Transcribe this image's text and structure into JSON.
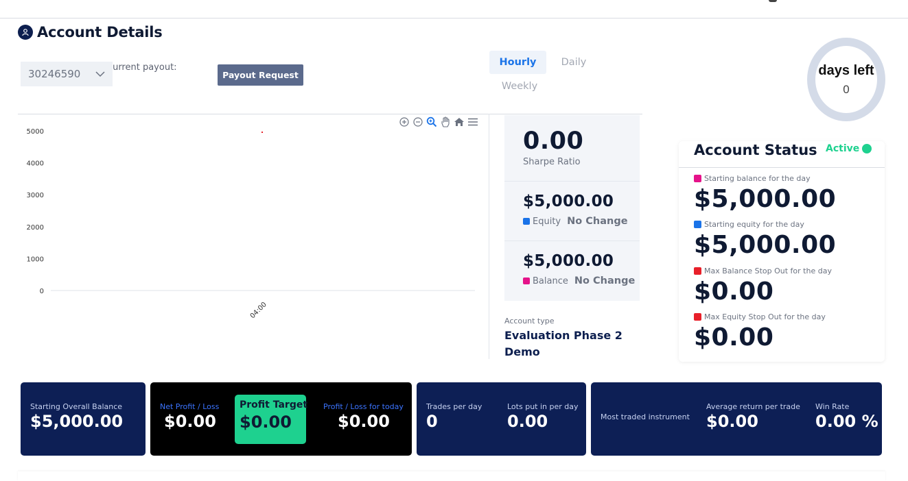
{
  "header": {
    "title": "Account Details"
  },
  "account": {
    "selected_id": "30246590",
    "current_payout_label": "Current payout:"
  },
  "payout_button_label": "Payout Request",
  "tabs": [
    {
      "label": "Hourly",
      "active": true
    },
    {
      "label": "Daily",
      "active": false
    },
    {
      "label": "Weekly",
      "active": false
    }
  ],
  "days_left": {
    "title": "days left",
    "value": "0"
  },
  "chart_data": {
    "type": "line",
    "x": [
      "04:00"
    ],
    "ylim": [
      0,
      5000
    ],
    "yticks": [
      "5000",
      "4000",
      "3000",
      "2000",
      "1000",
      "0"
    ],
    "series": [
      {
        "values": [
          5000
        ]
      }
    ],
    "colors": {
      "point": "#e8202a"
    },
    "grid": false
  },
  "chart_tools": [
    "zoom-in-icon",
    "zoom-out-icon",
    "zoom-select-icon",
    "pan-hand-icon",
    "home-icon",
    "menu-icon"
  ],
  "metrics": {
    "sharpe": {
      "value": "0.00",
      "label": "Sharpe Ratio"
    },
    "equity": {
      "value": "$5,000.00",
      "label": "Equity",
      "change": "No Change",
      "color": "#1a73e8"
    },
    "balance": {
      "value": "$5,000.00",
      "label": "Balance",
      "change": "No Change",
      "color": "#e5138a"
    }
  },
  "account_type": {
    "label": "Account type",
    "value": "Evaluation Phase 2 Demo"
  },
  "account_status": {
    "title": "Account Status",
    "status": "Active",
    "status_color": "#1ed18f",
    "items": [
      {
        "label": "Starting balance for the day",
        "value": "$5,000.00",
        "color": "#e5138a"
      },
      {
        "label": "Starting equity for the day",
        "value": "$5,000.00",
        "color": "#1a73e8"
      },
      {
        "label": "Max Balance Stop Out for the day",
        "value": "$0.00",
        "color": "#e8202a"
      },
      {
        "label": "Max Equity Stop Out for the day",
        "value": "$0.00",
        "color": "#e8202a"
      }
    ]
  },
  "summary": {
    "starting_overall_balance": {
      "label": "Starting Overall Balance",
      "value": "$5,000.00"
    },
    "net_profit_loss": {
      "label": "Net Profit / Loss",
      "value": "$0.00"
    },
    "profit_target": {
      "label": "Profit Target",
      "value": "$0.00"
    },
    "profit_loss_today": {
      "label": "Profit / Loss for today",
      "value": "$0.00"
    },
    "trades_per_day": {
      "label": "Trades per day",
      "value": "0"
    },
    "lots_per_day": {
      "label": "Lots put in per day",
      "value": "0.00"
    },
    "most_traded": {
      "label": "Most traded instrument"
    },
    "avg_return": {
      "label": "Average return per trade",
      "value": "$0.00"
    },
    "win_rate": {
      "label": "Win Rate",
      "value": "0.00 %"
    }
  }
}
